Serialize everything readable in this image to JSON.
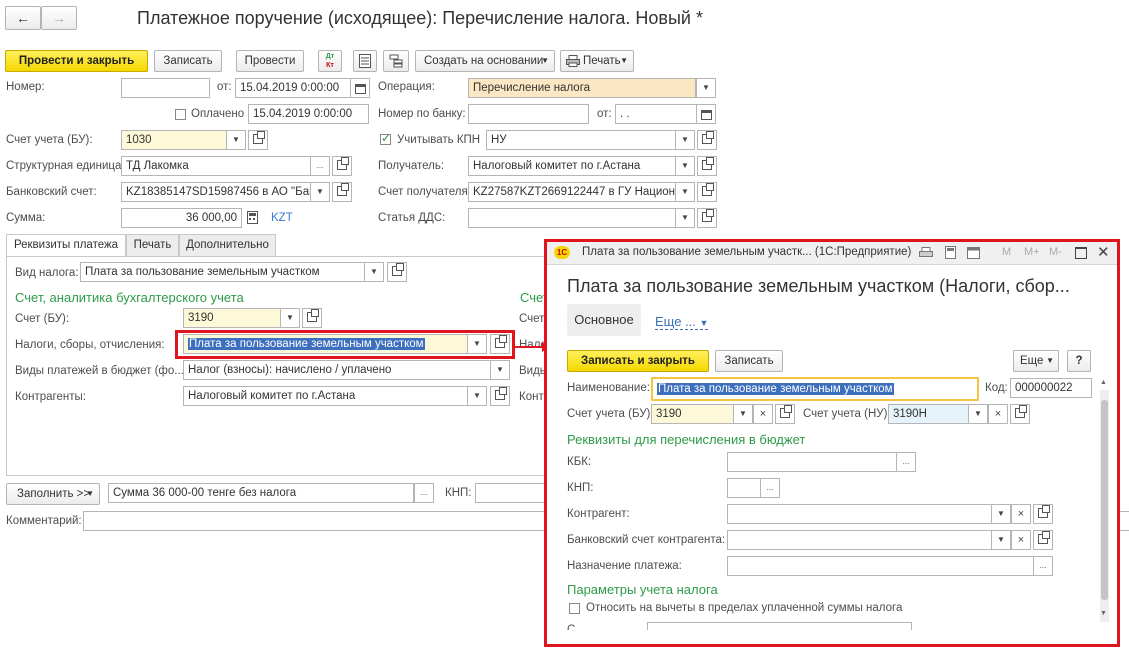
{
  "main": {
    "nav": {
      "back": "←",
      "forward": "→"
    },
    "title": "Платежное поручение (исходящее): Перечисление налога. Новый *",
    "toolbar": {
      "post_close": "Провести и закрыть",
      "save": "Записать",
      "post": "Провести",
      "dt_kt_top": "Дт",
      "dt_kt_bottom": "Кт",
      "create_based": "Создать на основании",
      "print": "Печать"
    },
    "fields": {
      "number_label": "Номер:",
      "number_value": "",
      "from_label": "от:",
      "date_value": "15.04.2019  0:00:00",
      "operation_label": "Операция:",
      "operation_value": "Перечисление налога",
      "paid_label": "Оплачено",
      "paid_date": "15.04.2019  0:00:00",
      "bank_number_label": "Номер по банку:",
      "bank_number_value": "",
      "bank_from_label": "от:",
      "bank_date_value": " .  .",
      "account_bu_label": "Счет учета (БУ):",
      "account_bu_value": "1030",
      "kpn_label": "Учитывать КПН",
      "kpn_value": "НУ",
      "struct_unit_label": "Структурная единица:",
      "struct_unit_value": "ТД Лакомка",
      "recipient_label": "Получатель:",
      "recipient_value": "Налоговый комитет по г.Астана",
      "bank_account_label": "Банковский счет:",
      "bank_account_value": "KZ18385147SD15987456 в АО \"Банк",
      "recipient_account_label": "Счет получателя:",
      "recipient_account_value": "KZ27587KZT2669122447 в ГУ Национал",
      "sum_label": "Сумма:",
      "sum_value": "36 000,00",
      "currency": "KZT",
      "dds_label": "Статья ДДС:",
      "dds_value": ""
    },
    "tabs": [
      "Реквизиты платежа",
      "Печать",
      "Дополнительно"
    ],
    "tab_content": {
      "tax_type_label": "Вид налога:",
      "tax_type_value": "Плата за пользование земельным участком",
      "section_title": "Счет, аналитика бухгалтерского учета",
      "section_title_right": "Счет",
      "account_label": "Счет (БУ):",
      "account_value": "3190",
      "account_right": "Счет",
      "taxes_label": "Налоги, сборы, отчисления:",
      "taxes_value": "Плата за пользование земельным участком",
      "taxes_right": "Нало",
      "payment_types_label": "Виды платежей в бюджет (фо...",
      "payment_types_value": "Налог (взносы): начислено / уплачено",
      "payment_types_right": "Виды",
      "counterparties_label": "Контрагенты:",
      "counterparties_value": "Налоговый комитет по г.Астана",
      "counterparties_right": "Конт"
    },
    "bottom": {
      "fill_button": "Заполнить >>",
      "purpose_value": "Сумма 36 000-00  тенге  без налога",
      "knp_label": "КНП:",
      "comment_label": "Комментарий:"
    }
  },
  "modal": {
    "window_title": "Плата за пользование земельным участк...  (1С:Предприятие)",
    "window_buttons": [
      "M",
      "M+",
      "M-"
    ],
    "heading": "Плата за пользование земельным участком (Налоги, сбор...",
    "tab_main": "Основное",
    "tab_more": "Еще ...",
    "save_close": "Записать и закрыть",
    "save": "Записать",
    "more_button": "Еще",
    "help": "?",
    "name_label": "Наименование:",
    "name_value": "Плата за пользование земельным участком",
    "code_label": "Код:",
    "code_value": "000000022",
    "account_bu_label": "Счет учета (БУ):",
    "account_bu_value": "3190",
    "account_nu_label": "Счет учета (НУ):",
    "account_nu_value": "3190Н",
    "budget_section": "Реквизиты для перечисления в бюджет",
    "kbk_label": "КБК:",
    "knp_label": "КНП:",
    "counterparty_label": "Контрагент:",
    "bank_account_label": "Банковский счет контрагента:",
    "purpose_label": "Назначение платежа:",
    "params_section": "Параметры учета налога",
    "deduct_label": "Относить на вычеты в пределах уплаченной суммы налога",
    "last_label": "С..."
  },
  "colors": {
    "accent_green": "#2e9a4a",
    "highlight_red": "#e0141e",
    "primary_yellow": "#f5d800",
    "currency_blue": "#3a7bd5"
  }
}
